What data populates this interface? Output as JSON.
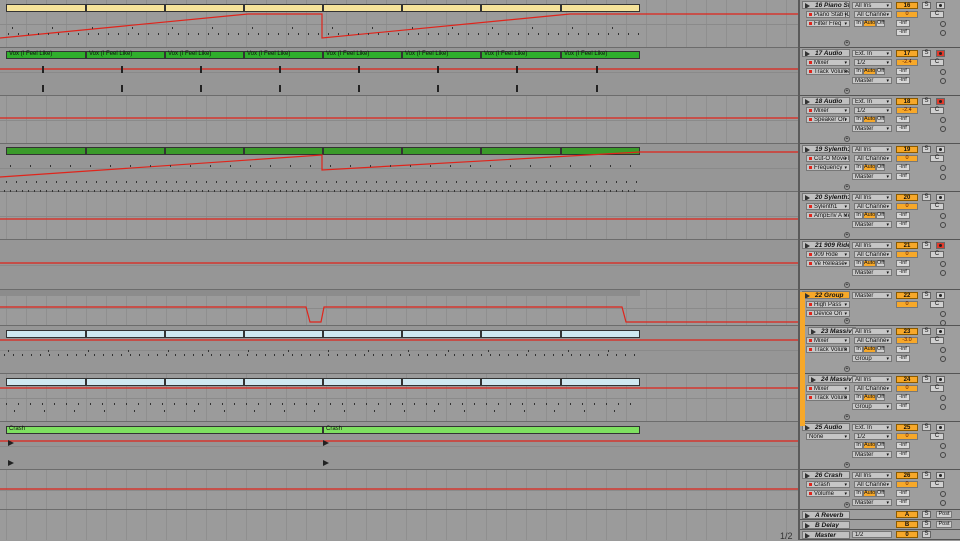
{
  "clips": {
    "vox": "Vox (I Feel Like)",
    "crash": "Crash"
  },
  "tracks": [
    {
      "name": "16 Piano Sta",
      "input": "All Ins",
      "row2": "Piano Stab [Di",
      "row2b": "All Channe",
      "row3": "Filter Freq",
      "num": "16",
      "vol": "0",
      "panL": "-inf",
      "panR": "-inf",
      "out": "",
      "armed": false
    },
    {
      "name": "17 Audio",
      "input": "Ext. In",
      "row2": "Mixer",
      "row2b": "1/2",
      "row3": "Track Volume",
      "num": "17",
      "vol": "-2.4",
      "panL": "-inf",
      "panR": "-inf",
      "out": "Master",
      "armed": true
    },
    {
      "name": "18 Audio",
      "input": "Ext. In",
      "row2": "Mixer",
      "row2b": "1/2",
      "row3": "Speaker On",
      "num": "18",
      "vol": "-2.4",
      "panL": "-inf",
      "panR": "-inf",
      "out": "Master",
      "armed": true
    },
    {
      "name": "19 Sylenth1",
      "input": "All Ins",
      "row2": "Cut-O Move L",
      "row2b": "All Channe",
      "row3": "Frequency",
      "num": "19",
      "vol": "0",
      "panL": "-inf",
      "panR": "-inf",
      "out": "Master",
      "armed": false
    },
    {
      "name": "20 Sylenth1",
      "input": "All Ins",
      "row2": "Sylenth1",
      "row2b": "All Channe",
      "row3": "AmpEnv A Rel",
      "num": "20",
      "vol": "0",
      "panL": "-inf",
      "panR": "-inf",
      "out": "Master",
      "armed": false
    },
    {
      "name": "21 909 Ride",
      "input": "All Ins",
      "row2": "909 Ride",
      "row2b": "All Channe",
      "row3": "Ve Release",
      "num": "21",
      "vol": "0",
      "panL": "-inf",
      "panR": "-inf",
      "out": "Master",
      "armed": true
    },
    {
      "name": "22 Group",
      "input": "Master",
      "row2": "High Pass",
      "row2b": "",
      "row3": "Device On",
      "num": "22",
      "vol": "0",
      "panL": "",
      "panR": "",
      "out": "",
      "armed": false
    },
    {
      "name": "23 Massiv",
      "input": "All Ins",
      "row2": "Mixer",
      "row2b": "All Channe",
      "row3": "Track Volum",
      "num": "23",
      "vol": "-3.0",
      "panL": "-inf",
      "panR": "-inf",
      "out": "Group",
      "armed": false
    },
    {
      "name": "24 Massiv",
      "input": "All Ins",
      "row2": "Mixer",
      "row2b": "All Channe",
      "row3": "Track Volum",
      "num": "24",
      "vol": "0",
      "panL": "-inf",
      "panR": "-inf",
      "out": "Group",
      "armed": false
    },
    {
      "name": "25 Audio",
      "input": "Ext. In",
      "row2": "None",
      "row2b": "1/2",
      "row3": "",
      "num": "25",
      "vol": "0",
      "panL": "-inf",
      "panR": "-inf",
      "out": "Master",
      "armed": false
    },
    {
      "name": "26 Crash",
      "input": "All Ins",
      "row2": "Crash",
      "row2b": "All Channe",
      "row3": "Volume",
      "num": "26",
      "vol": "0",
      "panL": "-inf",
      "panR": "-inf",
      "out": "Master",
      "armed": false
    }
  ],
  "returns": [
    {
      "name": "A Reverb",
      "num": "A",
      "post": "Post"
    },
    {
      "name": "B Delay",
      "num": "B",
      "post": "Post"
    },
    {
      "name": "Master",
      "out": "1/2",
      "num": "0"
    }
  ],
  "labels": {
    "in": "In",
    "auto": "Auto",
    "off": "Off",
    "solo": "S",
    "c": "C"
  },
  "pager": "1/2",
  "colors": {
    "piano": "#f6e39a",
    "vox": "#2fae2c",
    "sylenth": "#3a9a2a",
    "massive": "#cfe8f0",
    "crash": "#7ee060",
    "automation": "#e0241b",
    "accent": "#f7a829"
  }
}
